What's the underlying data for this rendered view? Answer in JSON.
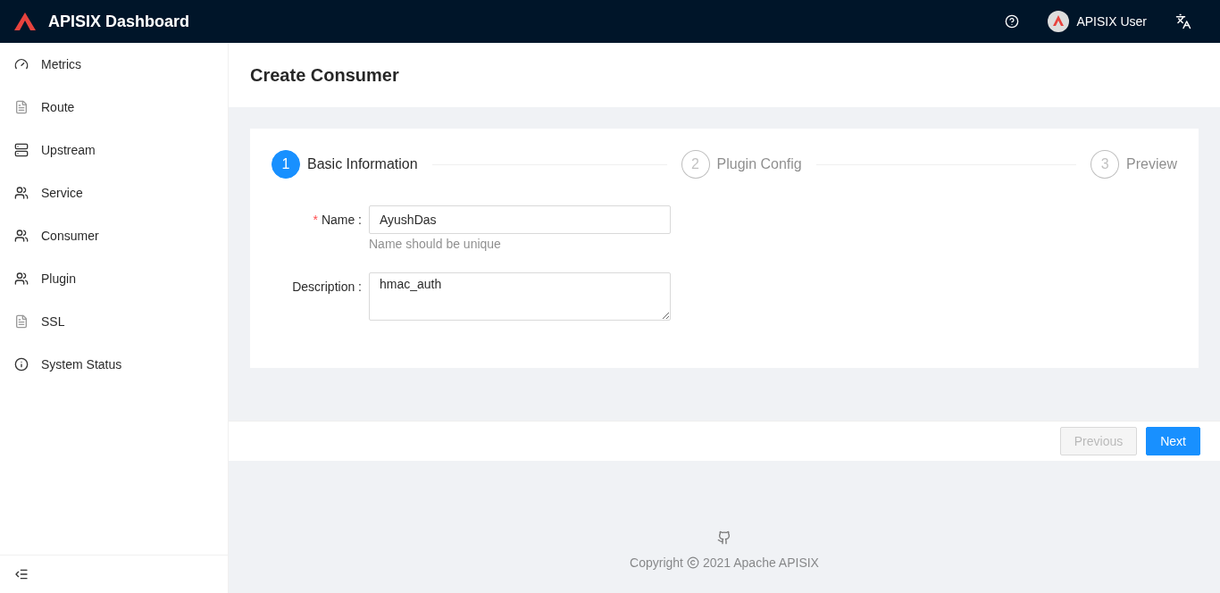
{
  "header": {
    "title": "APISIX Dashboard",
    "user": "APISIX User"
  },
  "sidebar": {
    "items": [
      {
        "label": "Metrics",
        "kind": "gauge",
        "selected": false
      },
      {
        "label": "Route",
        "kind": "doc",
        "selected": false
      },
      {
        "label": "Upstream",
        "kind": "server",
        "selected": false
      },
      {
        "label": "Service",
        "kind": "users",
        "selected": false
      },
      {
        "label": "Consumer",
        "kind": "users",
        "selected": false
      },
      {
        "label": "Plugin",
        "kind": "users",
        "selected": false
      },
      {
        "label": "SSL",
        "kind": "cert",
        "selected": false
      },
      {
        "label": "System Status",
        "kind": "info",
        "selected": false
      }
    ]
  },
  "page": {
    "title": "Create Consumer"
  },
  "steps": [
    {
      "number": "1",
      "label": "Basic Information",
      "selected": true
    },
    {
      "number": "2",
      "label": "Plugin Config",
      "selected": false
    },
    {
      "number": "3",
      "label": "Preview",
      "selected": false
    }
  ],
  "form": {
    "fields": [
      {
        "marker": "*",
        "label": "Name :",
        "value": "AyushDas",
        "help": "Name should be unique",
        "kind": "input"
      },
      {
        "label": "Description :",
        "value": "hmac_auth",
        "kind": "textarea"
      }
    ]
  },
  "actions": [
    {
      "label": "Previous",
      "disabled": true
    },
    {
      "label": "Next",
      "disabled": false
    }
  ],
  "footer": {
    "prefix": "Copyright",
    "text": "2021 Apache APISIX"
  }
}
